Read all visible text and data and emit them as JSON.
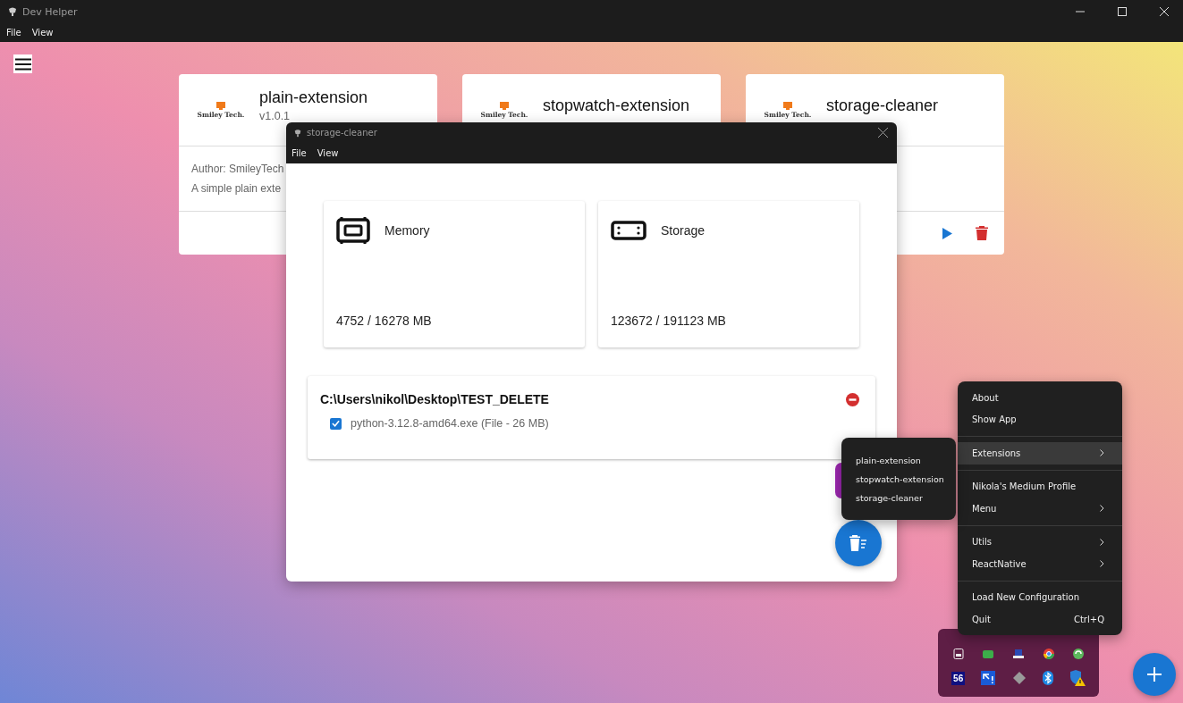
{
  "window": {
    "title": "Dev Helper",
    "menu": [
      "File",
      "View"
    ]
  },
  "extensions": [
    {
      "name": "plain-extension",
      "logo_text": "Smiley Tech.",
      "version": "v1.0.1",
      "author": "Author: SmileyTech",
      "description": "A simple plain exte"
    },
    {
      "name": "stopwatch-extension",
      "logo_text": "Smiley Tech."
    },
    {
      "name": "storage-cleaner",
      "logo_text": "Smiley Tech.",
      "actions": [
        {
          "kind": "play"
        },
        {
          "kind": "delete"
        }
      ]
    }
  ],
  "dialog": {
    "title": "storage-cleaner",
    "menu": [
      "File",
      "View"
    ],
    "stats": [
      {
        "kind": "memory",
        "label": "Memory",
        "value": "4752 / 16278 MB"
      },
      {
        "kind": "storage",
        "label": "Storage",
        "value": "123672 / 191123 MB"
      }
    ],
    "folders": [
      {
        "path": "C:\\Users\\nikol\\Desktop\\TEST_DELETE",
        "files": [
          {
            "name": "python-3.12.8-amd64.exe (File - 26 MB)",
            "checked": true
          }
        ]
      }
    ]
  },
  "tray_menu": [
    [
      {
        "label": "About",
        "has_submenu": false,
        "selected": false
      },
      {
        "label": "Show App",
        "has_submenu": false,
        "selected": false
      }
    ],
    [
      {
        "label": "Extensions",
        "has_submenu": true,
        "selected": true
      }
    ],
    [
      {
        "label": "Nikola's Medium Profile",
        "has_submenu": false,
        "selected": false
      },
      {
        "label": "Menu",
        "has_submenu": true,
        "selected": false
      }
    ],
    [
      {
        "label": "Utils",
        "has_submenu": true,
        "selected": false
      },
      {
        "label": "ReactNative",
        "has_submenu": true,
        "selected": false
      }
    ],
    [
      {
        "label": "Load New Configuration",
        "has_submenu": false,
        "selected": false
      },
      {
        "label": "Quit",
        "shortcut": "Ctrl+Q",
        "has_submenu": false,
        "selected": false
      }
    ]
  ],
  "extensions_submenu": [
    "plain-extension",
    "stopwatch-extension",
    "storage-cleaner"
  ],
  "tray_icon_text": "56"
}
